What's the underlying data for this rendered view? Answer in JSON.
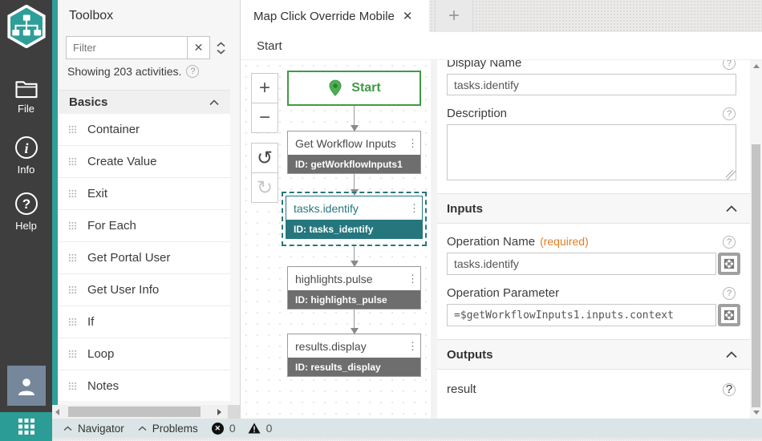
{
  "app": {
    "colors": {
      "accent_teal": "#2e9e99",
      "selection_teal": "#26767e",
      "start_green": "#3f9b43",
      "required_orange": "#e27d22",
      "statusbar_bg": "#dbe4e6",
      "sidebar_bg": "#3e3e3e"
    }
  },
  "sidebar": {
    "items": [
      {
        "label": "File",
        "icon": "folder-icon"
      },
      {
        "label": "Info",
        "icon": "info-circle-icon"
      },
      {
        "label": "Help",
        "icon": "help-circle-icon"
      }
    ],
    "avatar_icon": "user-icon",
    "apps_icon": "apps-grid-icon",
    "logo_icon": "workflow-hexagon-logo"
  },
  "toolbox": {
    "title": "Toolbox",
    "filter_placeholder": "Filter",
    "clear_label": "✕",
    "summary": "Showing 203 activities.",
    "sections": [
      {
        "label": "Basics"
      }
    ],
    "items": [
      "Container",
      "Create Value",
      "Exit",
      "For Each",
      "Get Portal User",
      "Get User Info",
      "If",
      "Loop",
      "Notes"
    ]
  },
  "tabs": {
    "active": "Map Click Override Mobile",
    "close_label": "✕",
    "new_tab_label": "+"
  },
  "breadcrumb": {
    "path": "Start"
  },
  "canvas": {
    "zoom_in": "+",
    "zoom_out": "−",
    "undo": "↺",
    "redo": "↻",
    "kebab": "⋮",
    "nodes": [
      {
        "type": "start",
        "label": "Start"
      },
      {
        "title": "Get Workflow Inputs",
        "id": "ID: getWorkflowInputs1",
        "selected": false
      },
      {
        "title": "tasks.identify",
        "id": "ID: tasks_identify",
        "selected": true
      },
      {
        "title": "highlights.pulse",
        "id": "ID: highlights_pulse",
        "selected": false
      },
      {
        "title": "results.display",
        "id": "ID: results_display",
        "selected": false
      }
    ]
  },
  "properties": {
    "display_name_label": "Display Name",
    "display_name_value": "tasks.identify",
    "description_label": "Description",
    "description_value": "",
    "inputs_label": "Inputs",
    "operation_name_label": "Operation Name",
    "required_label": "(required)",
    "operation_name_value": "tasks.identify",
    "operation_parameter_label": "Operation Parameter",
    "operation_parameter_value": "=$getWorkflowInputs1.inputs.context",
    "outputs_label": "Outputs",
    "outputs": [
      "result"
    ],
    "help_glyph": "?"
  },
  "statusbar": {
    "navigator_label": "Navigator",
    "problems_label": "Problems",
    "error_count": "0",
    "warning_count": "0",
    "error_glyph": "✕"
  }
}
